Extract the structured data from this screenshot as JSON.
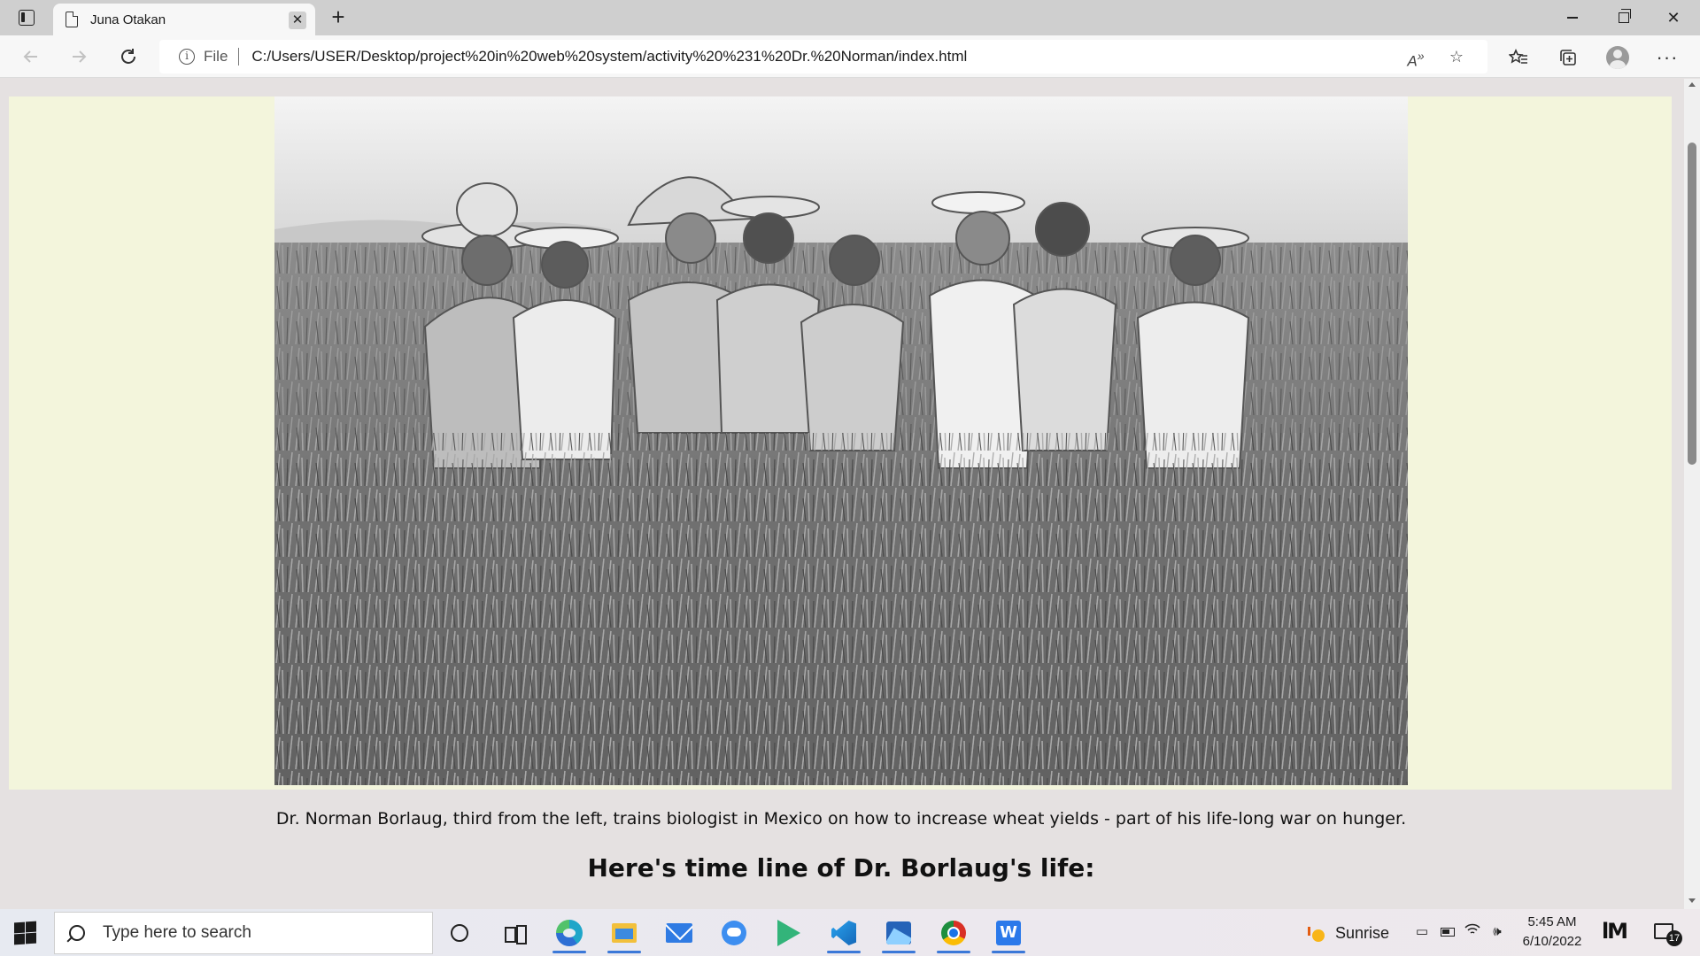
{
  "browser": {
    "tab_title": "Juna Otakan",
    "tab_close_glyph": "✕",
    "new_tab_glyph": "+",
    "address": {
      "protocol_label": "File",
      "url": "C:/Users/USER/Desktop/project%20in%20web%20system/activity%20%231%20Dr.%20Norman/index.html"
    },
    "icons": {
      "back": "arrow-left-icon",
      "forward": "arrow-right-icon",
      "refresh": "refresh-icon",
      "info": "info-icon",
      "read_aloud": "read-aloud-icon",
      "add_favorite": "star-plus-icon",
      "favorites": "favorites-icon",
      "collections": "collections-icon",
      "profile": "profile-icon",
      "more": "more-icon"
    }
  },
  "page": {
    "band_color": "#f3f5dc",
    "page_bg": "#e5e1e1",
    "photo_caption": "Dr. Norman Borlaug, third from the left, trains biologist in Mexico on how to increase wheat yields - part of his life-long war on hunger.",
    "timeline_heading": "Here's time line of Dr. Borlaug's life:"
  },
  "taskbar": {
    "search_placeholder": "Type here to search",
    "apps": [
      "cortana",
      "task-view",
      "edge",
      "file-explorer",
      "mail",
      "messenger",
      "google-play",
      "vscode",
      "photos",
      "chrome",
      "word"
    ],
    "weather_label": "Sunrise",
    "time": "5:45 AM",
    "date": "6/10/2022",
    "notification_count": "17",
    "accent": "#3b78d8"
  }
}
